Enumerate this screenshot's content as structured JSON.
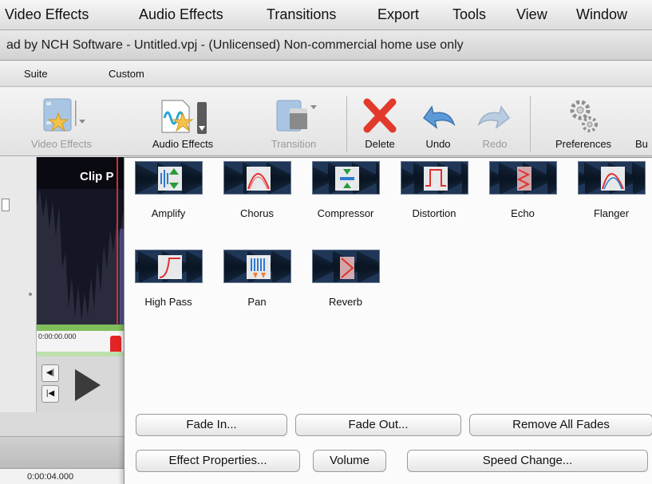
{
  "menubar": {
    "items": [
      "Video Effects",
      "Audio Effects",
      "Transitions",
      "Export",
      "Tools",
      "View",
      "Window"
    ]
  },
  "window": {
    "title": "ad by NCH Software - Untitled.vpj - (Unlicensed) Non-commercial home use only"
  },
  "tabs": [
    "Suite",
    "Custom"
  ],
  "toolbar": {
    "video_effects": "Video Effects",
    "audio_effects": "Audio Effects",
    "transition": "Transition",
    "delete": "Delete",
    "undo": "Undo",
    "redo": "Redo",
    "preferences": "Preferences",
    "truncated": "Bu"
  },
  "preview": {
    "title_fragment": "Clip P",
    "timecode": "0:00:00.000"
  },
  "timeline": {
    "timecode": "0:00:04.000"
  },
  "effects_menu": {
    "items": [
      {
        "label": "Amplify",
        "icon": "amplify-icon"
      },
      {
        "label": "Chorus",
        "icon": "chorus-icon"
      },
      {
        "label": "Compressor",
        "icon": "compressor-icon"
      },
      {
        "label": "Distortion",
        "icon": "distortion-icon"
      },
      {
        "label": "Echo",
        "icon": "echo-icon"
      },
      {
        "label": "Flanger",
        "icon": "flanger-icon"
      },
      {
        "label": "High Pass",
        "icon": "high-pass-icon"
      },
      {
        "label": "Pan",
        "icon": "pan-icon"
      },
      {
        "label": "Reverb",
        "icon": "reverb-icon"
      }
    ],
    "buttons": {
      "fade_in": "Fade In...",
      "fade_out": "Fade Out...",
      "remove_all_fades": "Remove All Fades",
      "effect_properties": "Effect Properties...",
      "volume": "Volume",
      "speed_change": "Speed Change..."
    }
  },
  "colors": {
    "waveform_bg": "#1f3656",
    "waveform": "#0b1624",
    "accent_red": "#e03030",
    "accent_green": "#2a9a3c"
  }
}
